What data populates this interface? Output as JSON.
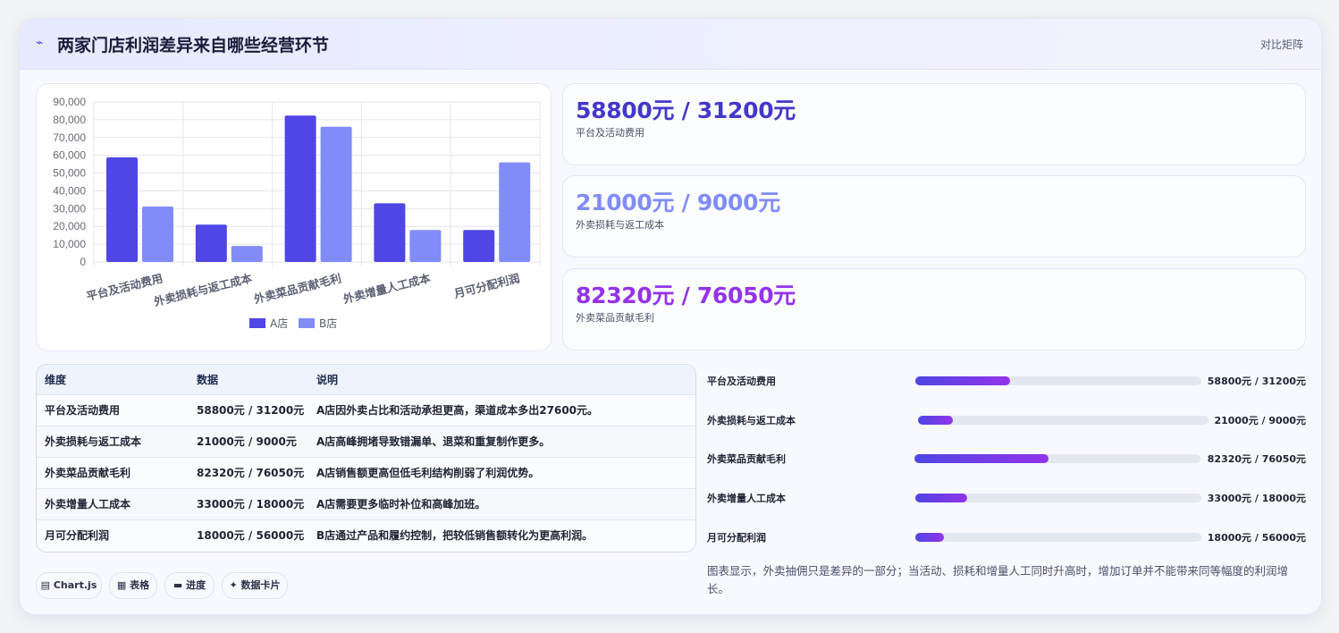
{
  "header": {
    "icon": "trend-icon",
    "title": "两家门店利润差异来自哪些经营环节",
    "mode_label": "对比矩阵"
  },
  "colors": {
    "store_a": "#4f46e5",
    "store_b": "#818cf8",
    "accent_purple": "#9333ea"
  },
  "chart_data": {
    "type": "bar",
    "categories": [
      "平台及活动费用",
      "外卖损耗与返工成本",
      "外卖菜品贡献毛利",
      "外卖增量人工成本",
      "月可分配利润"
    ],
    "series": [
      {
        "name": "A店",
        "values": [
          58800,
          21000,
          82320,
          33000,
          18000
        ]
      },
      {
        "name": "B店",
        "values": [
          31200,
          9000,
          76050,
          18000,
          56000
        ]
      }
    ],
    "ylim": [
      0,
      90000
    ],
    "yticks": [
      "0",
      "10,000",
      "20,000",
      "30,000",
      "40,000",
      "50,000",
      "60,000",
      "70,000",
      "80,000",
      "90,000"
    ],
    "legend_position": "bottom",
    "grid": true
  },
  "stats": [
    {
      "value": "58800元 / 31200元",
      "label": "平台及活动费用",
      "color": "#4338ca"
    },
    {
      "value": "21000元 / 9000元",
      "label": "外卖损耗与返工成本",
      "color": "#818cf8"
    },
    {
      "value": "82320元 / 76050元",
      "label": "外卖菜品贡献毛利",
      "color": "#9333ea"
    }
  ],
  "table": {
    "headers": [
      "维度",
      "数据",
      "说明"
    ],
    "rows": [
      [
        "平台及活动费用",
        "58800元 / 31200元",
        "A店因外卖占比和活动承担更高，渠道成本多出27600元。"
      ],
      [
        "外卖损耗与返工成本",
        "21000元 / 9000元",
        "A店高峰拥堵导致错漏单、退菜和重复制作更多。"
      ],
      [
        "外卖菜品贡献毛利",
        "82320元 / 76050元",
        "A店销售额更高但低毛利结构削弱了利润优势。"
      ],
      [
        "外卖增量人工成本",
        "33000元 / 18000元",
        "A店需要更多临时补位和高峰加班。"
      ],
      [
        "月可分配利润",
        "18000元 / 56000元",
        "B店通过产品和履约控制，把较低销售额转化为更高利润。"
      ]
    ]
  },
  "chips": [
    {
      "icon": "▤",
      "label": "Chart.js"
    },
    {
      "icon": "▦",
      "label": "表格"
    },
    {
      "icon": "▬",
      "label": "进度"
    },
    {
      "icon": "✦",
      "label": "数据卡片"
    }
  ],
  "progress": [
    {
      "label": "平台及活动费用",
      "value": "58800元 / 31200元",
      "fraction": 0.33
    },
    {
      "label": "外卖损耗与返工成本",
      "value": "21000元 / 9000元",
      "fraction": 0.12
    },
    {
      "label": "外卖菜品贡献毛利",
      "value": "82320元 / 76050元",
      "fraction": 0.47
    },
    {
      "label": "外卖增量人工成本",
      "value": "33000元 / 18000元",
      "fraction": 0.18
    },
    {
      "label": "月可分配利润",
      "value": "18000元 / 56000元",
      "fraction": 0.1
    }
  ],
  "summary": "图表显示，外卖抽佣只是差异的一部分；当活动、损耗和增量人工同时升高时，增加订单并不能带来同等幅度的利润增长。"
}
